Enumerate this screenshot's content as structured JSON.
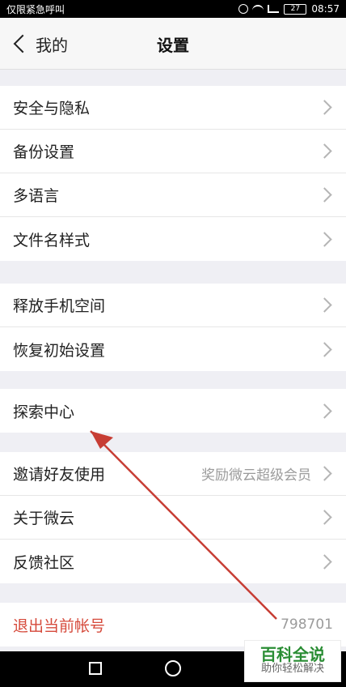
{
  "status_bar": {
    "left_text": "仅限紧急呼叫",
    "battery": "27",
    "time": "08:57"
  },
  "header": {
    "back_label": "我的",
    "title": "设置"
  },
  "sections": {
    "security": [
      {
        "label": "安全与隐私"
      },
      {
        "label": "备份设置"
      },
      {
        "label": "多语言"
      },
      {
        "label": "文件名样式"
      }
    ],
    "storage": [
      {
        "label": "释放手机空间"
      },
      {
        "label": "恢复初始设置"
      }
    ],
    "explore": [
      {
        "label": "探索中心"
      }
    ],
    "social": [
      {
        "label": "邀请好友使用",
        "value": "奖励微云超级会员"
      },
      {
        "label": "关于微云"
      },
      {
        "label": "反馈社区"
      }
    ]
  },
  "logout": {
    "label": "退出当前帐号",
    "value": "798701"
  },
  "watermark": {
    "top": "百科全说",
    "bottom": "助你轻松解决"
  }
}
